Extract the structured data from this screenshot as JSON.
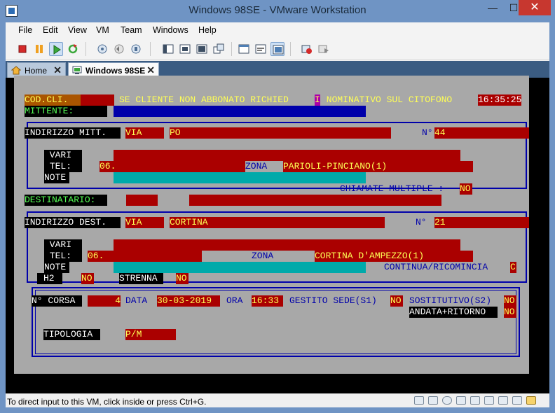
{
  "window": {
    "title": "Windows 98SE - VMware Workstation",
    "min_glyph": "—",
    "max_glyph": "☐",
    "close_glyph": "✕"
  },
  "menu": [
    "File",
    "Edit",
    "View",
    "VM",
    "Team",
    "Windows",
    "Help"
  ],
  "tabs": [
    {
      "label": "Home",
      "close": "✕"
    },
    {
      "label": "Windows 98SE",
      "close": "✕"
    }
  ],
  "status": {
    "text": "To direct input to this VM, click inside or press Ctrl+G."
  },
  "dos": {
    "cod_cli_label": "COD.CLI.",
    "banner_left": "SE CLIENTE NON ABBONATO RICHIED",
    "banner_cursor": "I",
    "banner_right": " NOMINATIVO SUL CITOFONO",
    "clock": "16:35:25",
    "mittente_label": "MITTENTE:",
    "indirizzo_mitt_label": "INDIRIZZO MITT.",
    "mitt_via": "VIA",
    "mitt_street": "PO",
    "mitt_num_label": "N°",
    "mitt_num": "44",
    "vari_label": " VARI ",
    "tel_label": " TEL: ",
    "note_label": "NOTE",
    "mitt_tel_prefix": "06.",
    "zona_label": "ZONA",
    "mitt_zona": "PARIOLI-PINCIANO(1)",
    "chiamate_label": "CHIAMATE MULTIPLE :",
    "chiamate_value": "NO",
    "destinatario_label": "DESTINATARIO:",
    "indirizzo_dest_label": "INDIRIZZO DEST.",
    "dest_via": "VIA",
    "dest_street": "CORTINA",
    "dest_num_label": "N°",
    "dest_num": "21",
    "dest_tel_prefix": "06.",
    "dest_zona": "CORTINA D'AMPEZZO(1)",
    "continua_label": "CONTINUA/RICOMINCIA",
    "continua_value": "C",
    "h2_label": "H2",
    "h2_value": "NO",
    "strenna_label": "STRENNA",
    "strenna_value": "NO",
    "corsa_label": "N° CORSA",
    "corsa_value": "4",
    "data_label": "DATA",
    "data_value": "30-03-2019",
    "ora_label": "ORA",
    "ora_value": "16:33",
    "gestito_label": "GESTITO SEDE(S1)",
    "gestito_value": "NO",
    "sostitutivo_label": "SOSTITUTIVO(S2)",
    "sostitutivo_value": "NO",
    "andata_label": "ANDATA+RITORNO",
    "andata_value": "NO",
    "tipologia_label": "TIPOLOGIA",
    "tipologia_value": "P/M"
  }
}
